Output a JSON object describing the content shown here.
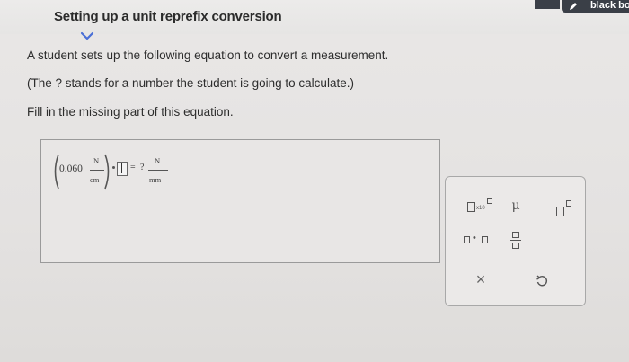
{
  "header": {
    "title": "Setting up a unit reprefix conversion",
    "tool_label": "black bo"
  },
  "question": {
    "line1": "A student sets up the following equation to convert a measurement.",
    "line2": "(The ? stands for a number the student is going to calculate.)",
    "line3": "Fill in the missing part of this equation."
  },
  "equation": {
    "value": "0.060",
    "unit_num": "N",
    "unit_den": "cm",
    "equals": "=",
    "unknown": "?",
    "result_num": "N",
    "result_den": "mm"
  },
  "palette": {
    "times_ten_label": "x10",
    "mu_label": "μ",
    "dot_label": "•",
    "clear_label": "×",
    "undo_icon": "undo-icon"
  }
}
